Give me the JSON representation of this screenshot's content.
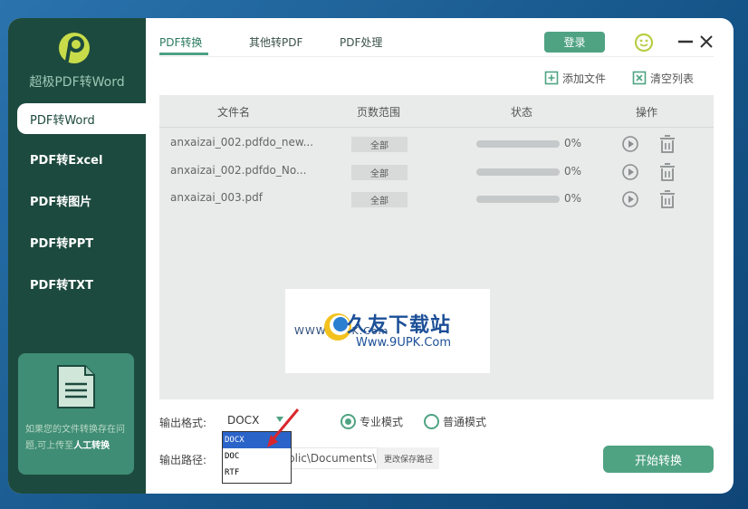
{
  "app": {
    "name": "超极PDF转Word",
    "colors": {
      "sidebar": "#1d4a3e",
      "accent": "#4fa383",
      "panel": "#e9eaea"
    }
  },
  "sidebar": {
    "items": [
      {
        "label": "PDF转Word",
        "active": true
      },
      {
        "label": "PDF转Excel",
        "active": false
      },
      {
        "label": "PDF转图片",
        "active": false
      },
      {
        "label": "PDF转PPT",
        "active": false
      },
      {
        "label": "PDF转TXT",
        "active": false
      }
    ],
    "help": {
      "text": "如果您的文件转换存在问题,可上传至",
      "link": "人工转换"
    }
  },
  "tabs": [
    {
      "label": "PDF转换",
      "active": true
    },
    {
      "label": "其他转PDF",
      "active": false
    },
    {
      "label": "PDF处理",
      "active": false
    }
  ],
  "header": {
    "login_label": "登录"
  },
  "toolbar": {
    "add_file_label": "添加文件",
    "clear_list_label": "清空列表"
  },
  "table": {
    "columns": [
      "文件名",
      "页数范围",
      "状态",
      "操作"
    ],
    "rows": [
      {
        "filename": "anxaizai_002.pdfdo_new...",
        "range": "全部",
        "progress": 0,
        "percent": "0%"
      },
      {
        "filename": "anxaizai_002.pdfdo_No...",
        "range": "全部",
        "progress": 0,
        "percent": "0%"
      },
      {
        "filename": "anxaizai_003.pdf",
        "range": "全部",
        "progress": 0,
        "percent": "0%"
      }
    ]
  },
  "watermark": {
    "cn": "久友下载站",
    "url": "Www.9UPK.Com",
    "url_small": "WWW.9UPK.Com"
  },
  "output": {
    "format_label": "输出格式:",
    "format_value": "DOCX",
    "format_options": [
      "DOCX",
      "DOC",
      "RTF"
    ],
    "mode_pro": "专业模式",
    "mode_normal": "普通模式",
    "path_label": "输出路径:",
    "path_value": "blic\\Documents\\",
    "change_path_label": "更改保存路径",
    "start_label": "开始转换"
  }
}
